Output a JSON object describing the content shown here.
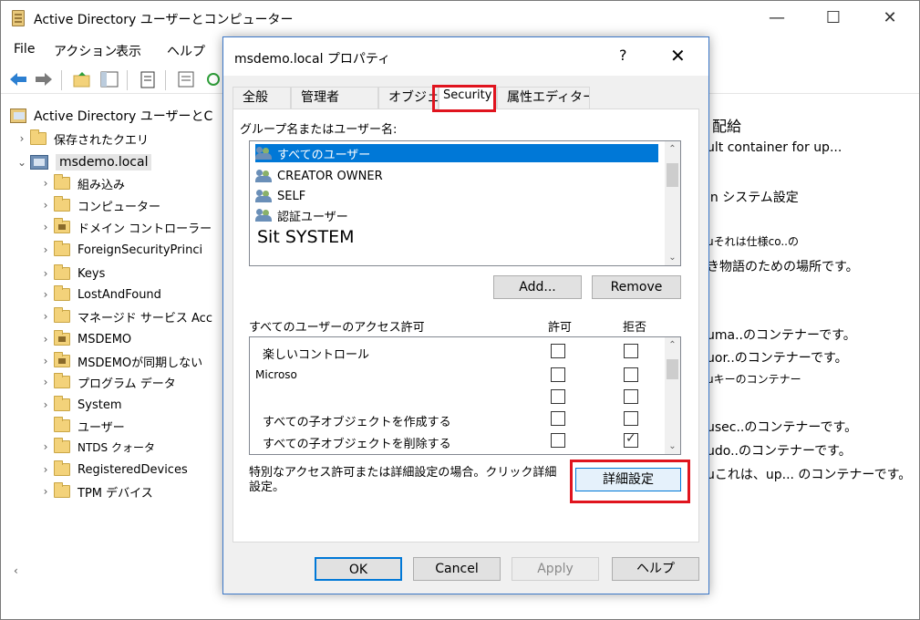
{
  "app": {
    "title": "Active Directory ユーザーとコンピューター",
    "menu": [
      "File",
      "アクション",
      "表示",
      "ヘルプ"
    ]
  },
  "tree": {
    "root_label": "Active Directory ユーザーとC",
    "saved_queries": "保存されたクエリ",
    "domain": "msdemo.local",
    "children": [
      "組み込み",
      "コンピューター",
      "ドメイン コントローラー",
      "ForeignSecurityPrinci",
      "Keys",
      "LostAndFound",
      "マネージド サービス Acc",
      "MSDEMO",
      "MSDEMOが同期しない",
      "プログラム データ",
      "System",
      "ユーザー",
      "NTDS クォータ",
      "RegisteredDevices",
      "TPM デバイス"
    ]
  },
  "right_pane": {
    "header": "配給",
    "lines": [
      "ult container for up...",
      "in システム設定",
      "uそれは仕様co..の",
      "き物語のための場所です。",
      "uma..のコンテナーです。",
      "uor..のコンテナーです。",
      "uキーのコンテナー",
      "usec..のコンテナーです。",
      "udo..のコンテナーです。",
      "uこれは、up... のコンテナーです。"
    ]
  },
  "dialog": {
    "title": "msdemo.local プロパティ",
    "help_glyph": "?",
    "close_glyph": "✕",
    "tabs": [
      "全般",
      "管理者",
      "オブジェクト",
      "Security",
      "属性エディター"
    ],
    "group_label": "グループ名またはユーザー名:",
    "users": [
      "すべてのユーザー",
      "CREATOR OWNER",
      "SELF",
      "認証ユーザー"
    ],
    "big_user": "Sit SYSTEM",
    "add_label": "Add...",
    "remove_label": "Remove",
    "perm_header": "すべてのユーザーのアクセス許可",
    "allow_label": "許可",
    "deny_label": "拒否",
    "permissions": [
      {
        "name": "楽しいコントロール",
        "allow": false,
        "deny": false
      },
      {
        "name": "Microso",
        "allow": false,
        "deny": false
      },
      {
        "name": "",
        "allow": false,
        "deny": false
      },
      {
        "name": "すべての子オブジェクトを作成する",
        "allow": false,
        "deny": false
      },
      {
        "name": "すべての子オブジェクトを削除する",
        "allow": false,
        "deny": true
      }
    ],
    "special_text": "特別なアクセス許可または詳細設定の場合。クリック詳細設定。",
    "advanced_label": "詳細設定",
    "ok_label": "OK",
    "cancel_label": "Cancel",
    "apply_label": "Apply",
    "help_label": "ヘルプ"
  },
  "colors": {
    "highlight": "#e0141e",
    "selection": "#0078d7",
    "dialog_border": "#3c78c8"
  }
}
